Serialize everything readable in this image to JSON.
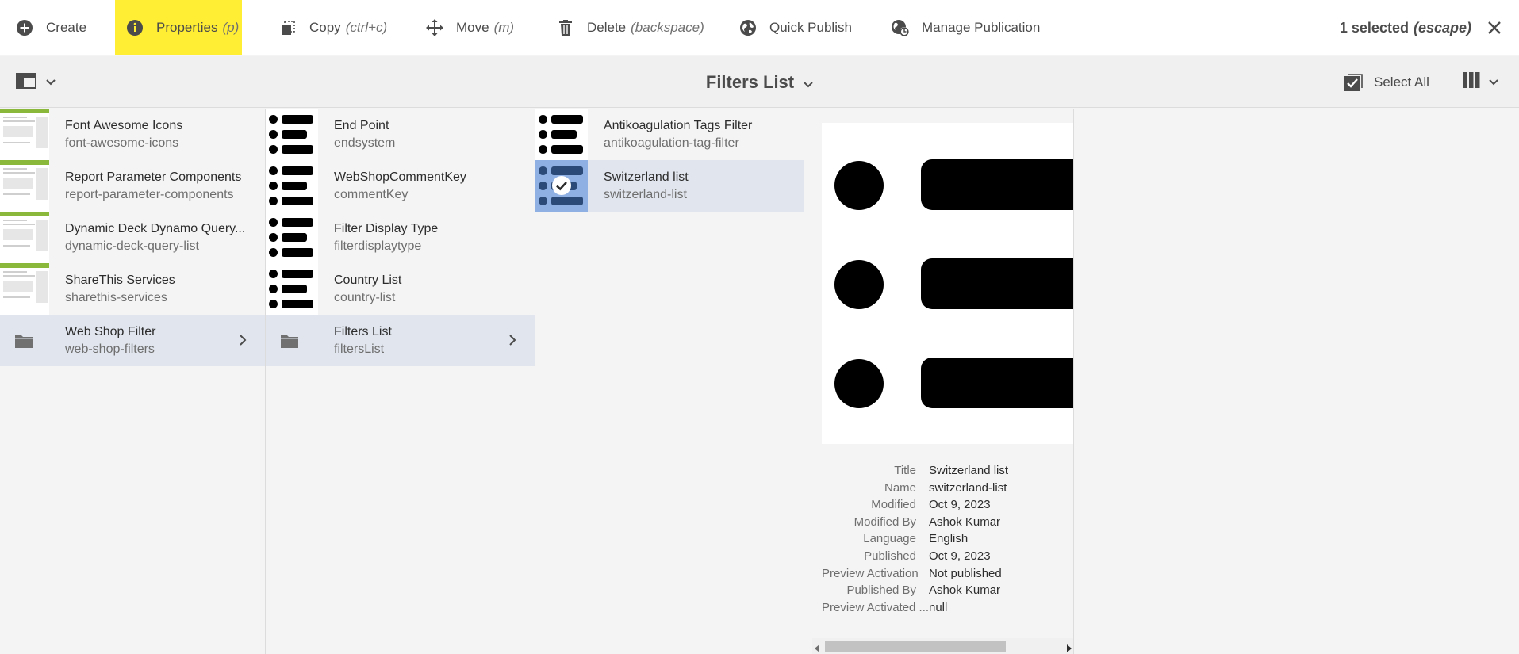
{
  "actions": [
    {
      "label": "Create",
      "shortcut": ""
    },
    {
      "label": "Properties",
      "shortcut": "(p)"
    },
    {
      "label": "Copy",
      "shortcut": "(ctrl+c)"
    },
    {
      "label": "Move",
      "shortcut": "(m)"
    },
    {
      "label": "Delete",
      "shortcut": "(backspace)"
    },
    {
      "label": "Quick Publish",
      "shortcut": ""
    },
    {
      "label": "Manage Publication",
      "shortcut": ""
    }
  ],
  "selection": {
    "count_label": "1 selected",
    "escape_label": "(escape)"
  },
  "toolbar": {
    "title": "Filters List",
    "select_all": "Select All"
  },
  "columns": [
    {
      "items": [
        {
          "title": "Font Awesome Icons",
          "name": "font-awesome-icons",
          "type": "page"
        },
        {
          "title": "Report Parameter Components",
          "name": "report-parameter-components",
          "type": "page"
        },
        {
          "title": "Dynamic Deck Dynamo Query...",
          "name": "dynamic-deck-query-list",
          "type": "page"
        },
        {
          "title": "ShareThis Services",
          "name": "sharethis-services",
          "type": "page"
        },
        {
          "title": "Web Shop Filter",
          "name": "web-shop-filters",
          "type": "folder"
        }
      ]
    },
    {
      "items": [
        {
          "title": "End Point",
          "name": "endsystem",
          "type": "list"
        },
        {
          "title": "WebShopCommentKey",
          "name": "commentKey",
          "type": "list"
        },
        {
          "title": "Filter Display Type",
          "name": "filterdisplaytype",
          "type": "list"
        },
        {
          "title": "Country List",
          "name": "country-list",
          "type": "list"
        },
        {
          "title": "Filters List",
          "name": "filtersList",
          "type": "folder"
        }
      ]
    },
    {
      "items": [
        {
          "title": "Antikoagulation Tags Filter",
          "name": "antikoagulation-tag-filter",
          "type": "list"
        },
        {
          "title": "Switzerland list",
          "name": "switzerland-list",
          "type": "list-checked"
        }
      ]
    }
  ],
  "metadata": [
    {
      "key": "Title",
      "value": "Switzerland list"
    },
    {
      "key": "Name",
      "value": "switzerland-list"
    },
    {
      "key": "Modified",
      "value": "Oct 9, 2023"
    },
    {
      "key": "Modified By",
      "value": "Ashok Kumar"
    },
    {
      "key": "Language",
      "value": "English"
    },
    {
      "key": "Published",
      "value": "Oct 9, 2023"
    },
    {
      "key": "Preview Activation",
      "value": "Not published"
    },
    {
      "key": "Published By",
      "value": "Ashok Kumar"
    },
    {
      "key": "Preview Activated ...",
      "value": "null"
    }
  ],
  "colors": {
    "highlight": "#ffee33",
    "selected_row": "#e1e6ee",
    "check_overlay": "#8fb0e3"
  },
  "icons": [
    "add-circle-icon",
    "info-icon",
    "copy-icon",
    "move-icon",
    "trash-icon",
    "globe-icon",
    "globe-clock-icon",
    "close-icon",
    "rail-toggle-icon",
    "chevron-down-icon",
    "select-all-icon",
    "column-view-icon",
    "folder-icon",
    "chevron-right-icon",
    "checkmark-icon"
  ]
}
